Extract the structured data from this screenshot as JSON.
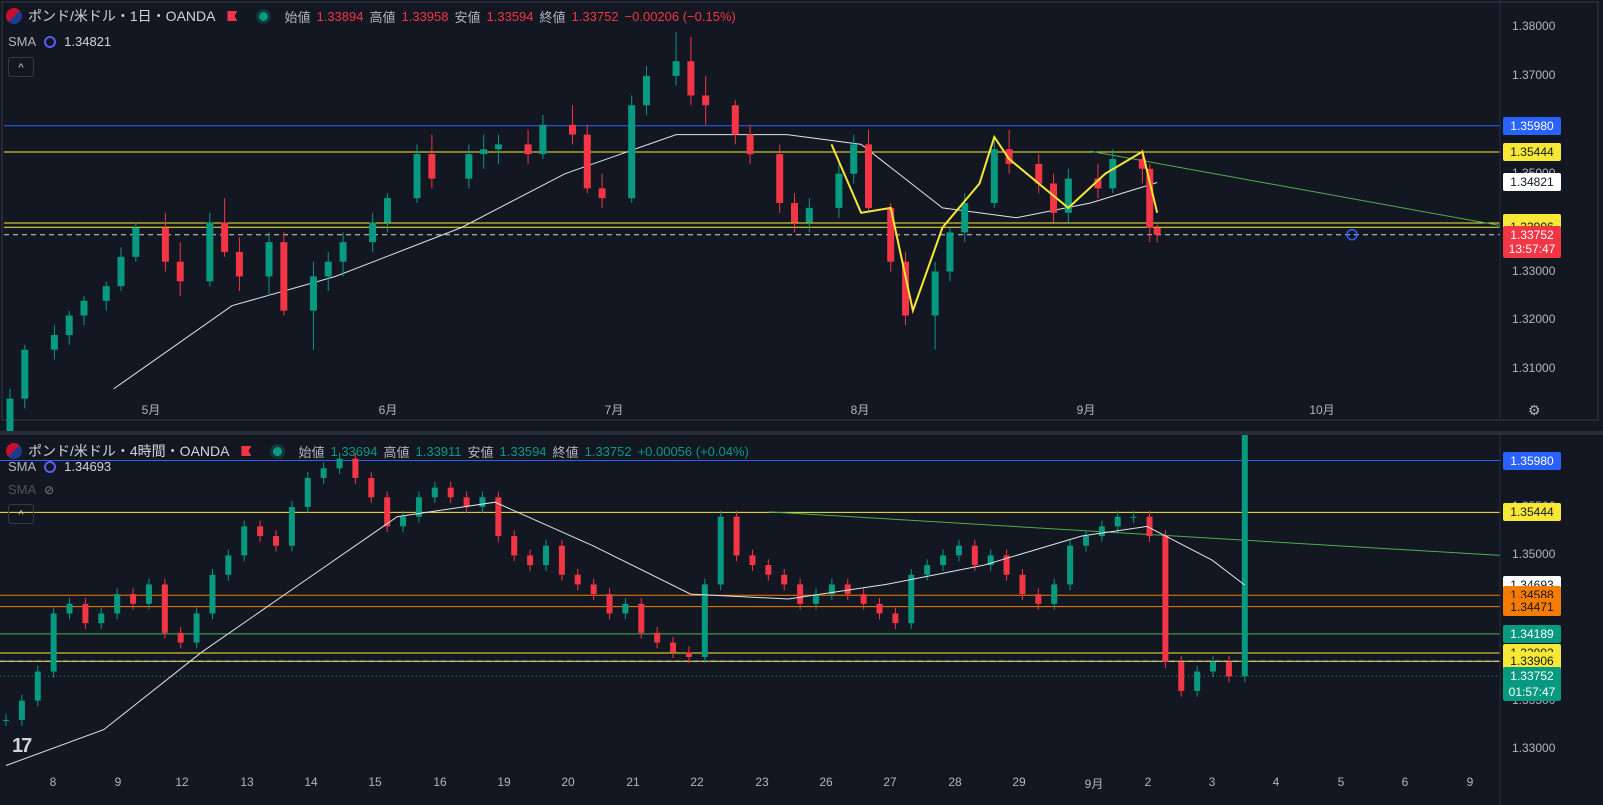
{
  "pane1": {
    "symbol": "ポンド/米ドル・1日・OANDA",
    "ohlc": {
      "o_label": "始値",
      "o": "1.33894",
      "h_label": "高値",
      "h": "1.33958",
      "l_label": "安値",
      "l": "1.33594",
      "c_label": "終値",
      "c": "1.33752",
      "change": "−0.00206 (−0.15%)"
    },
    "indicator": {
      "name": "SMA",
      "value": "1.34821"
    },
    "collapse": "^",
    "price_ticks": [
      "1.38000",
      "1.37000",
      "1.36000",
      "1.35000",
      "1.34000",
      "1.33000",
      "1.32000",
      "1.31000"
    ],
    "time_ticks": [
      "5月",
      "6月",
      "7月",
      "8月",
      "9月",
      "10月"
    ],
    "price_labels": [
      {
        "text": "1.35980",
        "bg": "#2962ff",
        "fg": "#ffffff",
        "price": 1.3598
      },
      {
        "text": "1.35444",
        "bg": "#f7e835",
        "fg": "#131722",
        "price": 1.35444
      },
      {
        "text": "1.34821",
        "bg": "#ffffff",
        "fg": "#131722",
        "price": 1.34821
      },
      {
        "text": "1.33992",
        "bg": "#f7e835",
        "fg": "#131722",
        "price": 1.33992
      },
      {
        "text": "1.33906",
        "bg": "#f7e835",
        "fg": "#131722",
        "price": 1.33906
      },
      {
        "text": "1.33752",
        "bg": "#f23645",
        "fg": "#ffffff",
        "price": 1.33752
      },
      {
        "text": "13:57:47",
        "bg": "#f23645",
        "fg": "#ffffff",
        "price": 1.3346
      }
    ]
  },
  "pane2": {
    "symbol": "ポンド/米ドル・4時間・OANDA",
    "ohlc": {
      "o_label": "始値",
      "o": "1.33694",
      "h_label": "高値",
      "h": "1.33911",
      "l_label": "安値",
      "l": "1.33594",
      "c_label": "終値",
      "c": "1.33752",
      "change": "+0.00056 (+0.04%)"
    },
    "indicator": {
      "name": "SMA",
      "value": "1.34693"
    },
    "indicator2": {
      "name": "SMA"
    },
    "collapse": "^",
    "price_ticks": [
      "1.35500",
      "1.35000",
      "1.34500",
      "1.34000",
      "1.33500",
      "1.33000"
    ],
    "time_ticks": [
      "8",
      "9",
      "12",
      "13",
      "14",
      "15",
      "16",
      "19",
      "20",
      "21",
      "22",
      "23",
      "26",
      "27",
      "28",
      "29",
      "9月",
      "2",
      "3",
      "4",
      "5",
      "6",
      "9"
    ],
    "price_labels": [
      {
        "text": "1.35980",
        "bg": "#2962ff",
        "fg": "#ffffff",
        "price": 1.3598
      },
      {
        "text": "1.35444",
        "bg": "#f7e835",
        "fg": "#131722",
        "price": 1.35444
      },
      {
        "text": "1.34693",
        "bg": "#ffffff",
        "fg": "#131722",
        "price": 1.34693
      },
      {
        "text": "1.34588",
        "bg": "#f57c00",
        "fg": "#131722",
        "price": 1.34588
      },
      {
        "text": "1.34471",
        "bg": "#f57c00",
        "fg": "#131722",
        "price": 1.34471
      },
      {
        "text": "1.34189",
        "bg": "#089981",
        "fg": "#ffffff",
        "price": 1.34189
      },
      {
        "text": "1.33992",
        "bg": "#f7e835",
        "fg": "#131722",
        "price": 1.33992
      },
      {
        "text": "1.33906",
        "bg": "#f7e835",
        "fg": "#131722",
        "price": 1.33906
      },
      {
        "text": "1.33752",
        "bg": "#089981",
        "fg": "#ffffff",
        "price": 1.33752
      },
      {
        "text": "01:57:47",
        "bg": "#089981",
        "fg": "#ffffff",
        "price": 1.3359
      }
    ]
  },
  "colors": {
    "bg": "#131722",
    "up": "#089981",
    "down": "#f23645",
    "sma": "#e0e3eb",
    "blue": "#2962ff",
    "yellow": "#f7e835",
    "orange": "#f57c00",
    "green_line": "#4caf50"
  },
  "chart_data": [
    {
      "type": "candlestick",
      "symbol": "ポンド/米ドル・1日・OANDA",
      "ylim": [
        1.305,
        1.381
      ],
      "x_range": [
        "2025-04-01",
        "2025-10-20"
      ],
      "candles": [
        [
          "2025-04-01",
          1.292,
          1.306,
          1.29,
          1.304
        ],
        [
          "2025-04-03",
          1.304,
          1.315,
          1.302,
          1.314
        ],
        [
          "2025-04-07",
          1.314,
          1.319,
          1.312,
          1.317
        ],
        [
          "2025-04-09",
          1.317,
          1.322,
          1.315,
          1.321
        ],
        [
          "2025-04-11",
          1.321,
          1.325,
          1.319,
          1.324
        ],
        [
          "2025-04-14",
          1.324,
          1.328,
          1.322,
          1.327
        ],
        [
          "2025-04-16",
          1.327,
          1.335,
          1.326,
          1.333
        ],
        [
          "2025-04-18",
          1.333,
          1.34,
          1.332,
          1.339
        ],
        [
          "2025-04-22",
          1.339,
          1.342,
          1.33,
          1.332
        ],
        [
          "2025-04-24",
          1.332,
          1.336,
          1.325,
          1.328
        ],
        [
          "2025-04-28",
          1.328,
          1.342,
          1.327,
          1.34
        ],
        [
          "2025-04-30",
          1.34,
          1.345,
          1.333,
          1.334
        ],
        [
          "2025-05-02",
          1.334,
          1.337,
          1.326,
          1.329
        ],
        [
          "2025-05-06",
          1.329,
          1.338,
          1.325,
          1.336
        ],
        [
          "2025-05-08",
          1.336,
          1.338,
          1.321,
          1.322
        ],
        [
          "2025-05-12",
          1.322,
          1.332,
          1.314,
          1.329
        ],
        [
          "2025-05-14",
          1.329,
          1.334,
          1.326,
          1.332
        ],
        [
          "2025-05-16",
          1.332,
          1.338,
          1.329,
          1.336
        ],
        [
          "2025-05-20",
          1.336,
          1.342,
          1.334,
          1.34
        ],
        [
          "2025-05-22",
          1.34,
          1.346,
          1.338,
          1.345
        ],
        [
          "2025-05-26",
          1.345,
          1.356,
          1.344,
          1.354
        ],
        [
          "2025-05-28",
          1.354,
          1.358,
          1.347,
          1.349
        ],
        [
          "2025-06-02",
          1.349,
          1.356,
          1.347,
          1.354
        ],
        [
          "2025-06-04",
          1.354,
          1.358,
          1.351,
          1.355
        ],
        [
          "2025-06-06",
          1.355,
          1.358,
          1.352,
          1.356
        ],
        [
          "2025-06-10",
          1.356,
          1.359,
          1.352,
          1.354
        ],
        [
          "2025-06-12",
          1.354,
          1.362,
          1.353,
          1.36
        ],
        [
          "2025-06-16",
          1.36,
          1.364,
          1.356,
          1.358
        ],
        [
          "2025-06-18",
          1.358,
          1.36,
          1.346,
          1.347
        ],
        [
          "2025-06-20",
          1.347,
          1.35,
          1.343,
          1.345
        ],
        [
          "2025-06-24",
          1.345,
          1.366,
          1.344,
          1.364
        ],
        [
          "2025-06-26",
          1.364,
          1.372,
          1.362,
          1.37
        ],
        [
          "2025-06-30",
          1.37,
          1.379,
          1.368,
          1.373
        ],
        [
          "2025-07-02",
          1.373,
          1.378,
          1.364,
          1.366
        ],
        [
          "2025-07-04",
          1.366,
          1.37,
          1.36,
          1.364
        ],
        [
          "2025-07-08",
          1.364,
          1.365,
          1.356,
          1.358
        ],
        [
          "2025-07-10",
          1.358,
          1.36,
          1.352,
          1.354
        ],
        [
          "2025-07-14",
          1.354,
          1.356,
          1.342,
          1.344
        ],
        [
          "2025-07-16",
          1.344,
          1.346,
          1.338,
          1.34
        ],
        [
          "2025-07-18",
          1.34,
          1.345,
          1.338,
          1.343
        ],
        [
          "2025-07-22",
          1.343,
          1.352,
          1.341,
          1.35
        ],
        [
          "2025-07-24",
          1.35,
          1.358,
          1.348,
          1.356
        ],
        [
          "2025-07-26",
          1.356,
          1.359,
          1.342,
          1.343
        ],
        [
          "2025-07-29",
          1.343,
          1.344,
          1.33,
          1.332
        ],
        [
          "2025-07-31",
          1.332,
          1.334,
          1.319,
          1.321
        ],
        [
          "2025-08-04",
          1.321,
          1.332,
          1.314,
          1.33
        ],
        [
          "2025-08-06",
          1.33,
          1.339,
          1.328,
          1.338
        ],
        [
          "2025-08-08",
          1.338,
          1.346,
          1.336,
          1.344
        ],
        [
          "2025-08-12",
          1.344,
          1.357,
          1.343,
          1.355
        ],
        [
          "2025-08-14",
          1.355,
          1.359,
          1.35,
          1.352
        ],
        [
          "2025-08-18",
          1.352,
          1.354,
          1.346,
          1.348
        ],
        [
          "2025-08-20",
          1.348,
          1.35,
          1.34,
          1.342
        ],
        [
          "2025-08-22",
          1.342,
          1.351,
          1.34,
          1.349
        ],
        [
          "2025-08-26",
          1.349,
          1.352,
          1.345,
          1.347
        ],
        [
          "2025-08-28",
          1.347,
          1.355,
          1.346,
          1.353
        ],
        [
          "2025-09-01",
          1.353,
          1.355,
          1.348,
          1.351
        ],
        [
          "2025-09-02",
          1.351,
          1.352,
          1.336,
          1.3389
        ],
        [
          "2025-09-03",
          1.33894,
          1.33958,
          1.33594,
          1.33752
        ]
      ],
      "sma": [
        [
          "2025-04-15",
          1.306
        ],
        [
          "2025-05-01",
          1.323
        ],
        [
          "2025-05-15",
          1.329
        ],
        [
          "2025-06-01",
          1.339
        ],
        [
          "2025-06-15",
          1.35
        ],
        [
          "2025-06-30",
          1.358
        ],
        [
          "2025-07-15",
          1.358
        ],
        [
          "2025-07-25",
          1.356
        ],
        [
          "2025-08-05",
          1.343
        ],
        [
          "2025-08-15",
          1.341
        ],
        [
          "2025-08-25",
          1.344
        ],
        [
          "2025-09-03",
          1.34821
        ]
      ],
      "hlines": [
        1.3598,
        1.35444,
        1.33992,
        1.33906,
        1.33752
      ],
      "trendline": [
        [
          "2025-08-25",
          1.3546
        ],
        [
          "2025-10-20",
          1.339
        ]
      ],
      "drawing_zigzag": [
        [
          "2025-07-21",
          1.356
        ],
        [
          "2025-07-25",
          1.342
        ],
        [
          "2025-07-29",
          1.343
        ],
        [
          "2025-08-01",
          1.322
        ],
        [
          "2025-08-05",
          1.339
        ],
        [
          "2025-08-10",
          1.348
        ],
        [
          "2025-08-12",
          1.3575
        ],
        [
          "2025-08-14",
          1.353
        ],
        [
          "2025-08-18",
          1.348
        ],
        [
          "2025-08-22",
          1.343
        ],
        [
          "2025-08-27",
          1.35
        ],
        [
          "2025-09-01",
          1.3545
        ],
        [
          "2025-09-03",
          1.342
        ]
      ]
    },
    {
      "type": "candlestick",
      "symbol": "ポンド/米ドル・4時間・OANDA",
      "ylim": [
        1.3264,
        1.362
      ],
      "bar_count": 200,
      "candles_4h_closes": [
        1.333,
        1.335,
        1.338,
        1.344,
        1.345,
        1.343,
        1.344,
        1.346,
        1.345,
        1.347,
        1.342,
        1.341,
        1.344,
        1.348,
        1.35,
        1.353,
        1.352,
        1.351,
        1.355,
        1.358,
        1.359,
        1.36,
        1.358,
        1.356,
        1.353,
        1.354,
        1.356,
        1.357,
        1.356,
        1.355,
        1.356,
        1.352,
        1.35,
        1.349,
        1.351,
        1.348,
        1.347,
        1.346,
        1.344,
        1.345,
        1.342,
        1.341,
        1.34,
        1.3395,
        1.347,
        1.354,
        1.35,
        1.349,
        1.348,
        1.347,
        1.345,
        1.346,
        1.347,
        1.346,
        1.345,
        1.344,
        1.343,
        1.348,
        1.349,
        1.35,
        1.351,
        1.349,
        1.35,
        1.348,
        1.346,
        1.345,
        1.347,
        1.351,
        1.352,
        1.353,
        1.354,
        1.354,
        1.352,
        1.339,
        1.336,
        1.338,
        1.339,
        1.3375,
        1.3752
      ],
      "sma": [
        [
          0,
          1.3283
        ],
        [
          15,
          1.332
        ],
        [
          30,
          1.34
        ],
        [
          45,
          1.347
        ],
        [
          60,
          1.354
        ],
        [
          75,
          1.3555
        ],
        [
          90,
          1.351
        ],
        [
          105,
          1.346
        ],
        [
          120,
          1.3455
        ],
        [
          135,
          1.347
        ],
        [
          150,
          1.349
        ],
        [
          165,
          1.352
        ],
        [
          175,
          1.353
        ],
        [
          185,
          1.3495
        ],
        [
          190,
          1.34693
        ]
      ],
      "hlines": [
        1.3598,
        1.35444,
        1.34588,
        1.34471,
        1.34189,
        1.33992,
        1.33906,
        1.33752
      ],
      "trendline": [
        [
          117,
          1.3545
        ],
        [
          230,
          1.3505
        ]
      ]
    }
  ]
}
